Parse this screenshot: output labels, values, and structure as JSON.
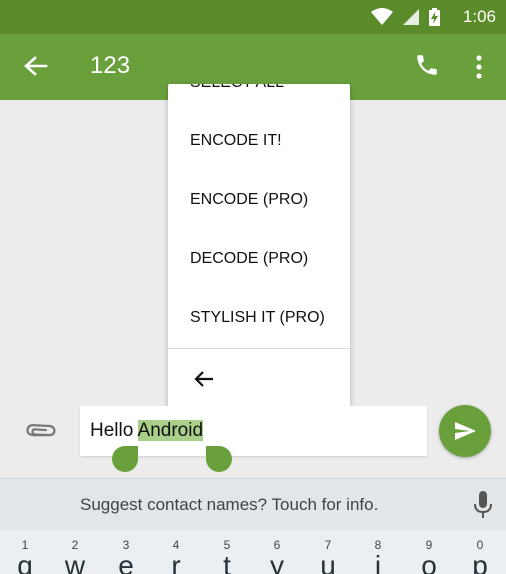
{
  "status_bar": {
    "time": "1:06",
    "icons": [
      "wifi-icon",
      "signal-icon",
      "battery-charging-icon"
    ]
  },
  "app_bar": {
    "title": "123",
    "back_icon": "arrow-back-icon",
    "actions": [
      "phone-icon",
      "more-vert-icon"
    ]
  },
  "context_menu": {
    "items": [
      "SELECT ALL",
      "ENCODE IT!",
      "ENCODE (PRO)",
      "DECODE (PRO)",
      "STYLISH IT (PRO)"
    ],
    "back_icon": "arrow-back-icon"
  },
  "compose": {
    "attach_icon": "paperclip-icon",
    "text_plain": "Hello ",
    "text_selected": "Android",
    "send_icon": "send-icon"
  },
  "suggestion": {
    "text": "Suggest contact names? Touch for info.",
    "mic_icon": "mic-icon"
  },
  "keyboard": {
    "keys": [
      {
        "num": "1",
        "letter": "q"
      },
      {
        "num": "2",
        "letter": "w"
      },
      {
        "num": "3",
        "letter": "e"
      },
      {
        "num": "4",
        "letter": "r"
      },
      {
        "num": "5",
        "letter": "t"
      },
      {
        "num": "6",
        "letter": "y"
      },
      {
        "num": "7",
        "letter": "u"
      },
      {
        "num": "8",
        "letter": "i"
      },
      {
        "num": "9",
        "letter": "o"
      },
      {
        "num": "0",
        "letter": "p"
      }
    ]
  },
  "colors": {
    "app_bar": "#69a03c",
    "status_bar": "#5b8b2a",
    "selection": "#a8d08a"
  }
}
